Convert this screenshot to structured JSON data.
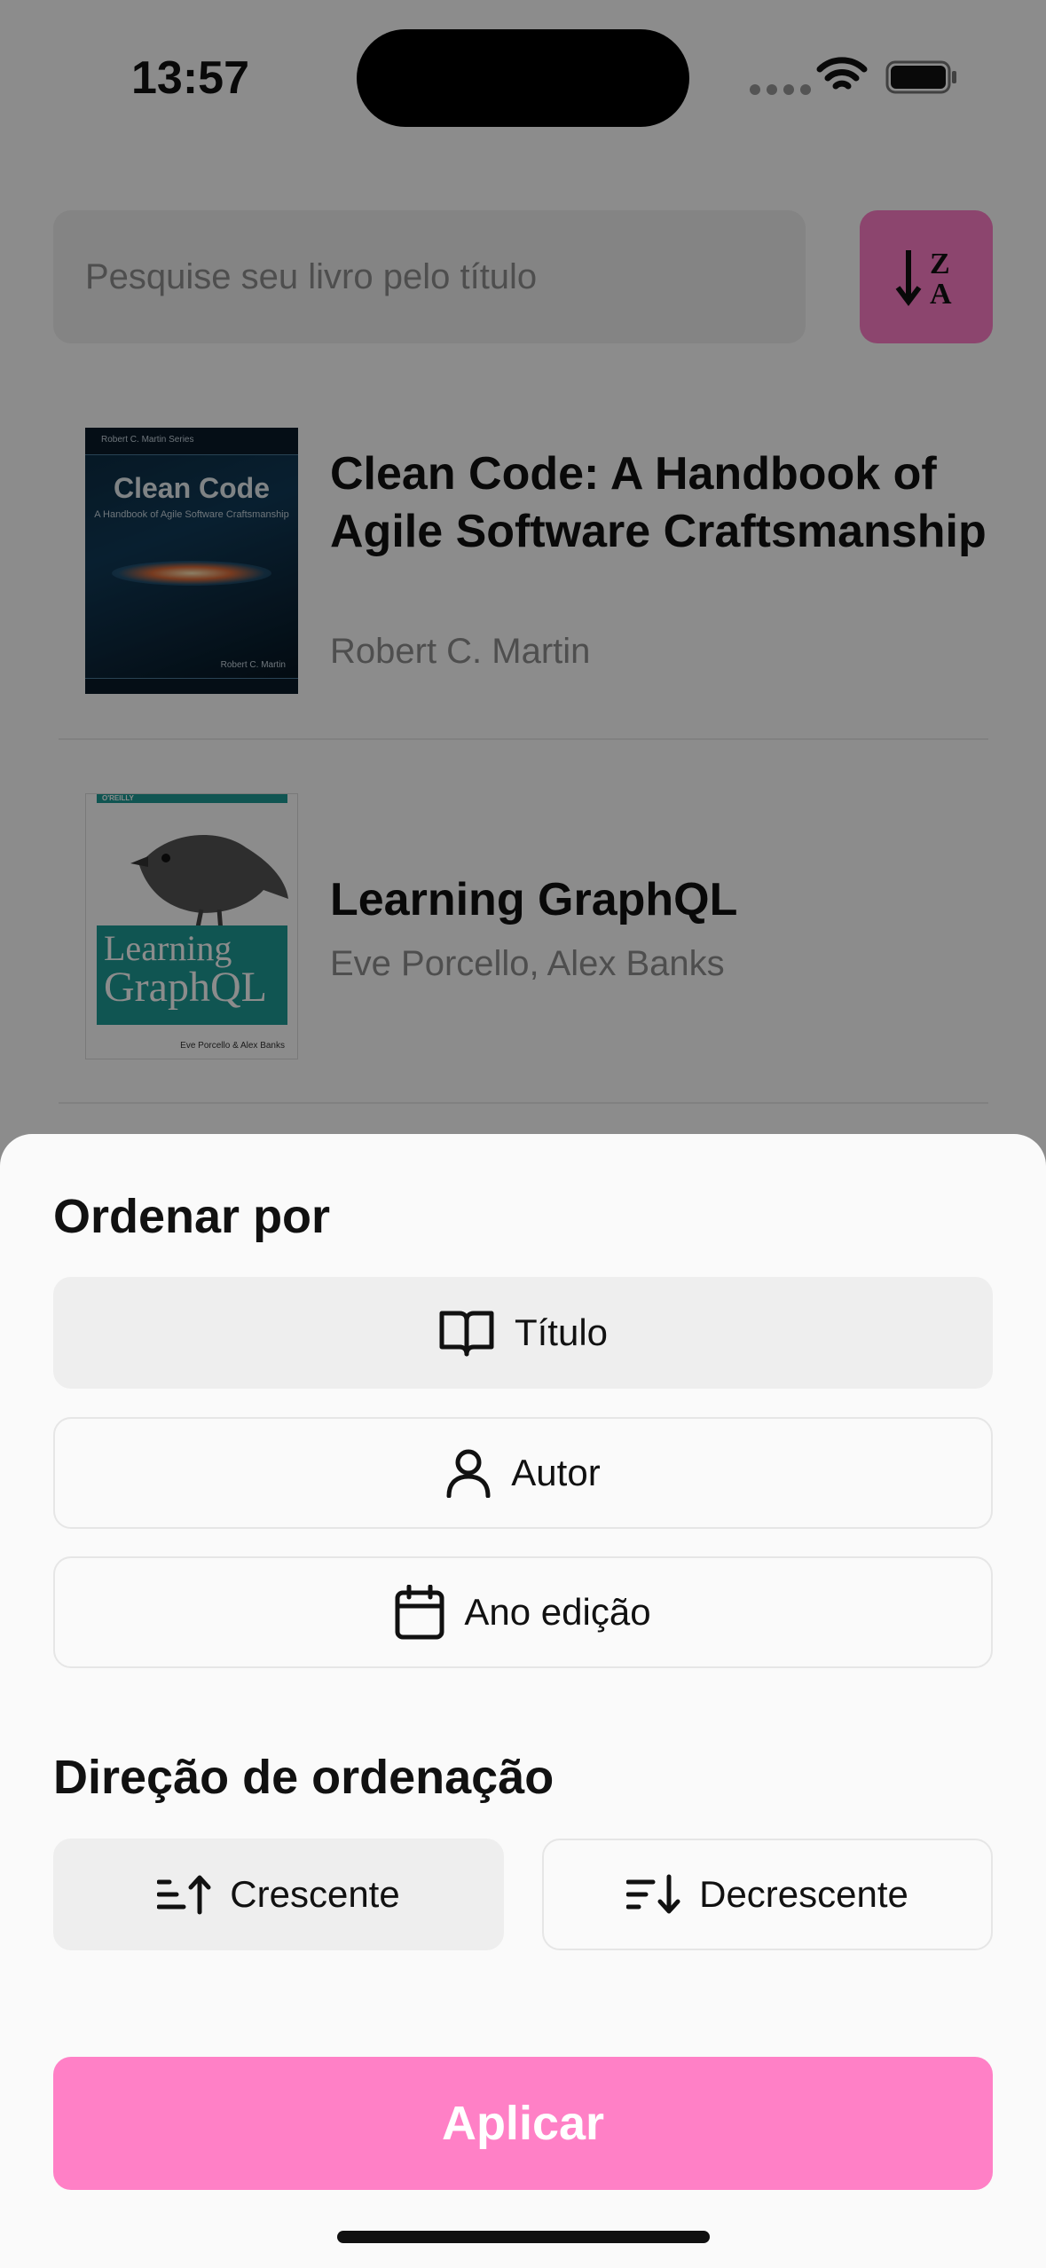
{
  "status_bar": {
    "time": "13:57"
  },
  "search": {
    "placeholder": "Pesquise seu livro pelo título"
  },
  "sort_button": {
    "icon": "sort-za-icon",
    "letter_top": "Z",
    "letter_bottom": "A"
  },
  "books": [
    {
      "title": "Clean Code: A Handbook of Agile Software Craftsmanship",
      "author": "Robert C. Martin",
      "cover": {
        "series": "Robert C. Martin Series",
        "title": "Clean Code",
        "subtitle": "A Handbook of Agile Software Craftsmanship",
        "author": "Robert C. Martin"
      }
    },
    {
      "title": "Learning GraphQL",
      "author": "Eve Porcello, Alex Banks",
      "cover": {
        "publisher": "O'REILLY",
        "title_line1": "Learning",
        "title_line2": "GraphQL",
        "authors": "Eve Porcello & Alex Banks"
      }
    }
  ],
  "sheet": {
    "sort_by_heading": "Ordenar por",
    "options": [
      {
        "label": "Título",
        "icon": "book-open-icon",
        "selected": true
      },
      {
        "label": "Autor",
        "icon": "user-icon",
        "selected": false
      },
      {
        "label": "Ano edição",
        "icon": "calendar-icon",
        "selected": false
      }
    ],
    "direction_heading": "Direção de ordenação",
    "directions": [
      {
        "label": "Crescente",
        "icon": "sort-ascending-icon",
        "selected": true
      },
      {
        "label": "Decrescente",
        "icon": "sort-descending-icon",
        "selected": false
      }
    ],
    "apply_label": "Aplicar"
  },
  "colors": {
    "accent": "#ff80c6",
    "selected_bg": "#eeeeee"
  }
}
